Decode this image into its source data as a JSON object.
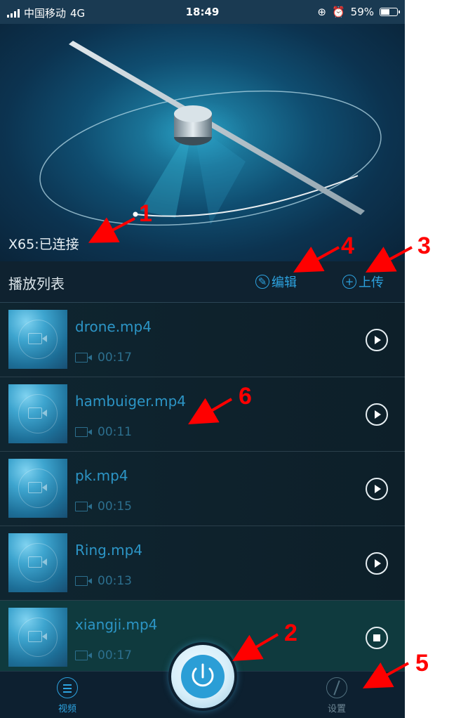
{
  "status_bar": {
    "carrier": "中国移动",
    "network": "4G",
    "time": "18:49",
    "battery": "59%",
    "battery_level": 0.59
  },
  "device": {
    "connection_status": "X65:已连接"
  },
  "playlist": {
    "title": "播放列表",
    "edit_label": "编辑",
    "upload_label": "上传",
    "items": [
      {
        "name": "drone.mp4",
        "duration": "00:17",
        "state": "play"
      },
      {
        "name": "hambuiger.mp4",
        "duration": "00:11",
        "state": "play"
      },
      {
        "name": "pk.mp4",
        "duration": "00:15",
        "state": "play"
      },
      {
        "name": "Ring.mp4",
        "duration": "00:13",
        "state": "play"
      },
      {
        "name": "xiangji.mp4",
        "duration": "00:17",
        "state": "stop"
      }
    ]
  },
  "tab_bar": {
    "video_label": "视频",
    "settings_label": "设置"
  },
  "annotations": {
    "a1": "1",
    "a2": "2",
    "a3": "3",
    "a4": "4",
    "a5": "5",
    "a6": "6"
  },
  "colors": {
    "accent": "#2da3e0",
    "annotation": "#ff0000"
  }
}
